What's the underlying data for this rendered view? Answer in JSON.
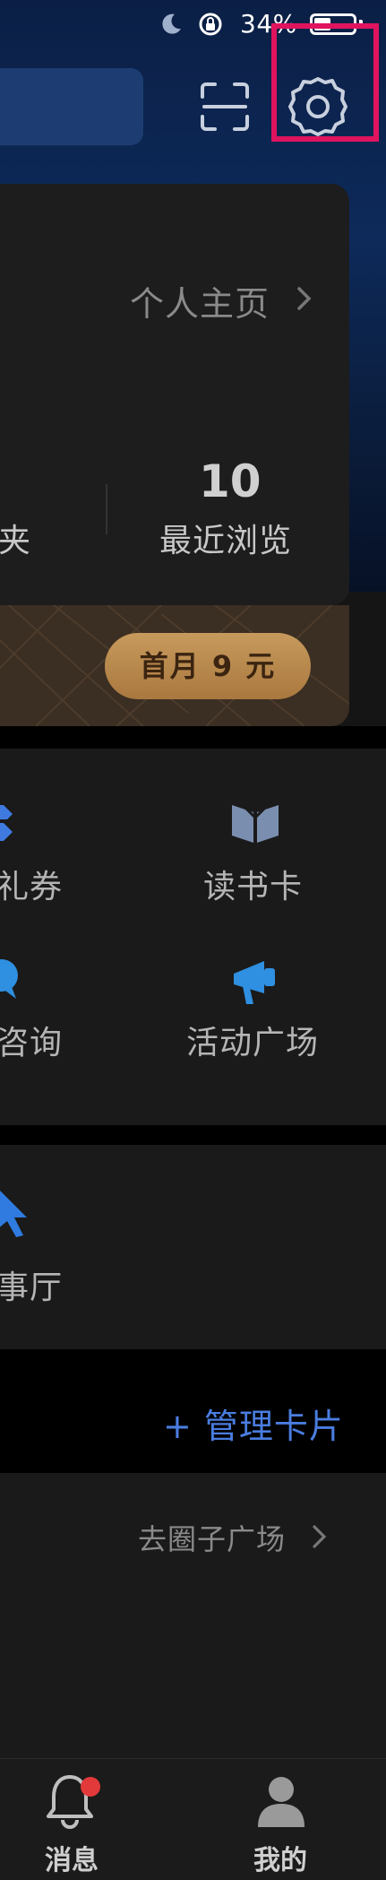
{
  "status_bar": {
    "battery_percent": "34%",
    "icons": [
      "moon-icon",
      "rotation-lock-icon",
      "battery-icon"
    ]
  },
  "header": {
    "scan_icon": "scan-icon",
    "settings_icon": "gear-icon",
    "highlight_color": "#e0145e"
  },
  "profile": {
    "homepage_link": "个人主页",
    "stats": [
      {
        "label": "夹"
      },
      {
        "value": "10",
        "label": "最近浏览"
      }
    ]
  },
  "vip": {
    "button_label": "首月 9 元"
  },
  "services_grid": {
    "items": [
      {
        "label": "礼券",
        "icon": "ticket-icon"
      },
      {
        "label": "读书卡",
        "icon": "book-icon"
      },
      {
        "label": "咨询",
        "icon": "chat-icon"
      },
      {
        "label": "活动广场",
        "icon": "megaphone-icon"
      }
    ]
  },
  "second_panel": {
    "items": [
      {
        "label": "事厅",
        "icon": "cursor-icon"
      }
    ]
  },
  "cards": {
    "manage_label": "+ 管理卡片"
  },
  "circle": {
    "link_label": "去圈子广场"
  },
  "tabbar": {
    "tabs": [
      {
        "label": "消息",
        "icon": "bell-icon"
      },
      {
        "label": "我的",
        "icon": "person-icon"
      }
    ]
  },
  "colors": {
    "accent_blue": "#4a7de0",
    "vip_gold": "#c79a5c",
    "badge_red": "#e23a3a"
  }
}
